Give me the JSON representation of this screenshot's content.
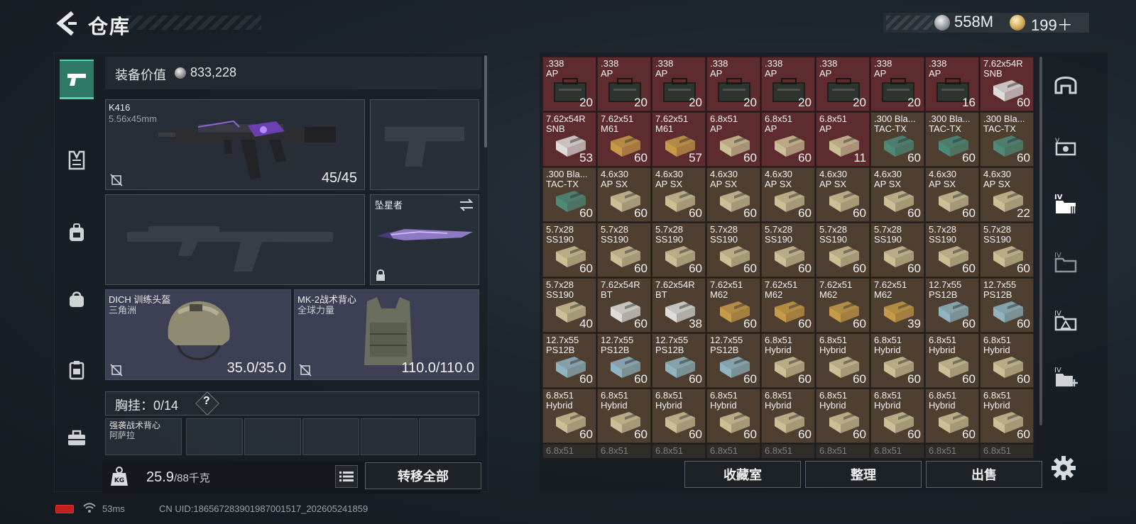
{
  "header": {
    "title": "仓库",
    "currency_1": "558M",
    "currency_2": "199＋"
  },
  "equipment": {
    "value_label": "装备价值",
    "value_amount": "833,228",
    "primary": {
      "name": "K416",
      "caliber": "5.56x45mm",
      "ammo": "45/45"
    },
    "melee": {
      "name": "坠星者"
    },
    "helmet": {
      "name": "DICH 训练头盔",
      "sub": "三角洲",
      "durability": "35.0/35.0"
    },
    "armor": {
      "name": "MK-2战术背心",
      "sub": "全球力量",
      "durability": "110.0/110.0"
    },
    "rig_label": "胸挂：0/14",
    "rig_help": "?",
    "rig_item_name": "强袭战术背心",
    "rig_item_sub": "阿萨拉",
    "weight_current": "25.9",
    "weight_max": "/88千克",
    "transfer_all": "转移全部"
  },
  "stash": {
    "cells": [
      {
        "l1": ".338",
        "l2": "AP",
        "qty": "20",
        "bg": "red",
        "box": "ammo-can"
      },
      {
        "l1": ".338",
        "l2": "AP",
        "qty": "20",
        "bg": "red",
        "box": "ammo-can"
      },
      {
        "l1": ".338",
        "l2": "AP",
        "qty": "20",
        "bg": "red",
        "box": "ammo-can"
      },
      {
        "l1": ".338",
        "l2": "AP",
        "qty": "20",
        "bg": "red",
        "box": "ammo-can"
      },
      {
        "l1": ".338",
        "l2": "AP",
        "qty": "20",
        "bg": "red",
        "box": "ammo-can"
      },
      {
        "l1": ".338",
        "l2": "AP",
        "qty": "20",
        "bg": "red",
        "box": "ammo-can"
      },
      {
        "l1": ".338",
        "l2": "AP",
        "qty": "20",
        "bg": "red",
        "box": "ammo-can"
      },
      {
        "l1": ".338",
        "l2": "AP",
        "qty": "16",
        "bg": "red",
        "box": "ammo-can"
      },
      {
        "l1": "7.62x54R",
        "l2": "SNB",
        "qty": "60",
        "bg": "red",
        "box": "white"
      },
      {
        "l1": "7.62x54R",
        "l2": "SNB",
        "qty": "53",
        "bg": "red",
        "box": "white"
      },
      {
        "l1": "7.62x51",
        "l2": "M61",
        "qty": "60",
        "bg": "red",
        "box": "gold"
      },
      {
        "l1": "7.62x51",
        "l2": "M61",
        "qty": "57",
        "bg": "red",
        "box": "gold"
      },
      {
        "l1": "6.8x51",
        "l2": "AP",
        "qty": "60",
        "bg": "red",
        "box": "tan"
      },
      {
        "l1": "6.8x51",
        "l2": "AP",
        "qty": "60",
        "bg": "red",
        "box": "tan"
      },
      {
        "l1": "6.8x51",
        "l2": "AP",
        "qty": "11",
        "bg": "red",
        "box": "tan"
      },
      {
        "l1": ".300 Bla...",
        "l2": "TAC-TX",
        "qty": "60",
        "bg": "brown",
        "box": "green"
      },
      {
        "l1": ".300 Bla...",
        "l2": "TAC-TX",
        "qty": "60",
        "bg": "brown",
        "box": "green"
      },
      {
        "l1": ".300 Bla...",
        "l2": "TAC-TX",
        "qty": "60",
        "bg": "brown",
        "box": "green"
      },
      {
        "l1": ".300 Bla...",
        "l2": "TAC-TX",
        "qty": "60",
        "bg": "brown",
        "box": "green"
      },
      {
        "l1": "4.6x30",
        "l2": "AP SX",
        "qty": "60",
        "bg": "brown",
        "box": "tan"
      },
      {
        "l1": "4.6x30",
        "l2": "AP SX",
        "qty": "60",
        "bg": "brown",
        "box": "tan"
      },
      {
        "l1": "4.6x30",
        "l2": "AP SX",
        "qty": "60",
        "bg": "brown",
        "box": "tan"
      },
      {
        "l1": "4.6x30",
        "l2": "AP SX",
        "qty": "60",
        "bg": "brown",
        "box": "tan"
      },
      {
        "l1": "4.6x30",
        "l2": "AP SX",
        "qty": "60",
        "bg": "brown",
        "box": "tan"
      },
      {
        "l1": "4.6x30",
        "l2": "AP SX",
        "qty": "60",
        "bg": "brown",
        "box": "tan"
      },
      {
        "l1": "4.6x30",
        "l2": "AP SX",
        "qty": "60",
        "bg": "brown",
        "box": "tan"
      },
      {
        "l1": "4.6x30",
        "l2": "AP SX",
        "qty": "22",
        "bg": "brown",
        "box": "tan"
      },
      {
        "l1": "5.7x28",
        "l2": "SS190",
        "qty": "60",
        "bg": "brown",
        "box": "tan"
      },
      {
        "l1": "5.7x28",
        "l2": "SS190",
        "qty": "60",
        "bg": "brown",
        "box": "tan"
      },
      {
        "l1": "5.7x28",
        "l2": "SS190",
        "qty": "60",
        "bg": "brown",
        "box": "tan"
      },
      {
        "l1": "5.7x28",
        "l2": "SS190",
        "qty": "60",
        "bg": "brown",
        "box": "tan"
      },
      {
        "l1": "5.7x28",
        "l2": "SS190",
        "qty": "60",
        "bg": "brown",
        "box": "tan"
      },
      {
        "l1": "5.7x28",
        "l2": "SS190",
        "qty": "60",
        "bg": "brown",
        "box": "tan"
      },
      {
        "l1": "5.7x28",
        "l2": "SS190",
        "qty": "60",
        "bg": "brown",
        "box": "tan"
      },
      {
        "l1": "5.7x28",
        "l2": "SS190",
        "qty": "60",
        "bg": "brown",
        "box": "tan"
      },
      {
        "l1": "5.7x28",
        "l2": "SS190",
        "qty": "60",
        "bg": "brown",
        "box": "tan"
      },
      {
        "l1": "5.7x28",
        "l2": "SS190",
        "qty": "40",
        "bg": "brown",
        "box": "tan"
      },
      {
        "l1": "7.62x54R",
        "l2": "BT",
        "qty": "60",
        "bg": "brown",
        "box": "white"
      },
      {
        "l1": "7.62x54R",
        "l2": "BT",
        "qty": "38",
        "bg": "brown",
        "box": "white"
      },
      {
        "l1": "7.62x51",
        "l2": "M62",
        "qty": "60",
        "bg": "brown",
        "box": "gold"
      },
      {
        "l1": "7.62x51",
        "l2": "M62",
        "qty": "60",
        "bg": "brown",
        "box": "gold"
      },
      {
        "l1": "7.62x51",
        "l2": "M62",
        "qty": "60",
        "bg": "brown",
        "box": "gold"
      },
      {
        "l1": "7.62x51",
        "l2": "M62",
        "qty": "39",
        "bg": "brown",
        "box": "gold"
      },
      {
        "l1": "12.7x55",
        "l2": "PS12B",
        "qty": "60",
        "bg": "brown",
        "box": "blue"
      },
      {
        "l1": "12.7x55",
        "l2": "PS12B",
        "qty": "60",
        "bg": "brown",
        "box": "blue"
      },
      {
        "l1": "12.7x55",
        "l2": "PS12B",
        "qty": "60",
        "bg": "brown",
        "box": "blue"
      },
      {
        "l1": "12.7x55",
        "l2": "PS12B",
        "qty": "60",
        "bg": "brown",
        "box": "blue"
      },
      {
        "l1": "12.7x55",
        "l2": "PS12B",
        "qty": "60",
        "bg": "brown",
        "box": "blue"
      },
      {
        "l1": "12.7x55",
        "l2": "PS12B",
        "qty": "60",
        "bg": "brown",
        "box": "blue"
      },
      {
        "l1": "6.8x51",
        "l2": "Hybrid",
        "qty": "60",
        "bg": "brown",
        "box": "tan"
      },
      {
        "l1": "6.8x51",
        "l2": "Hybrid",
        "qty": "60",
        "bg": "brown",
        "box": "tan"
      },
      {
        "l1": "6.8x51",
        "l2": "Hybrid",
        "qty": "60",
        "bg": "brown",
        "box": "tan"
      },
      {
        "l1": "6.8x51",
        "l2": "Hybrid",
        "qty": "60",
        "bg": "brown",
        "box": "tan"
      },
      {
        "l1": "6.8x51",
        "l2": "Hybrid",
        "qty": "60",
        "bg": "brown",
        "box": "tan"
      },
      {
        "l1": "6.8x51",
        "l2": "Hybrid",
        "qty": "60",
        "bg": "brown",
        "box": "tan"
      },
      {
        "l1": "6.8x51",
        "l2": "Hybrid",
        "qty": "60",
        "bg": "brown",
        "box": "tan"
      },
      {
        "l1": "6.8x51",
        "l2": "Hybrid",
        "qty": "60",
        "bg": "brown",
        "box": "tan"
      },
      {
        "l1": "6.8x51",
        "l2": "Hybrid",
        "qty": "60",
        "bg": "brown",
        "box": "tan"
      },
      {
        "l1": "6.8x51",
        "l2": "Hybrid",
        "qty": "60",
        "bg": "brown",
        "box": "tan"
      },
      {
        "l1": "6.8x51",
        "l2": "Hybrid",
        "qty": "60",
        "bg": "brown",
        "box": "tan"
      },
      {
        "l1": "6.8x51",
        "l2": "Hybrid",
        "qty": "60",
        "bg": "brown",
        "box": "tan"
      },
      {
        "l1": "6.8x51",
        "l2": "Hybrid",
        "qty": "60",
        "bg": "brown",
        "box": "tan"
      },
      {
        "l1": "6.8x51",
        "l2": "Hybrid",
        "qty": "60",
        "bg": "brown",
        "box": "tan"
      },
      {
        "l1": "6.8x51",
        "l2": "",
        "qty": "",
        "bg": "brown",
        "box": "tan",
        "faded": true
      },
      {
        "l1": "6.8x51",
        "l2": "",
        "qty": "",
        "bg": "brown",
        "box": "tan",
        "faded": true
      },
      {
        "l1": "6.8x51",
        "l2": "",
        "qty": "",
        "bg": "brown",
        "box": "tan",
        "faded": true
      },
      {
        "l1": "6.8x51",
        "l2": "",
        "qty": "",
        "bg": "brown",
        "box": "tan",
        "faded": true
      },
      {
        "l1": "6.8x51",
        "l2": "",
        "qty": "",
        "bg": "brown",
        "box": "tan",
        "faded": true
      },
      {
        "l1": "6.8x51",
        "l2": "",
        "qty": "",
        "bg": "brown",
        "box": "tan",
        "faded": true
      },
      {
        "l1": "6.8x51",
        "l2": "",
        "qty": "",
        "bg": "brown",
        "box": "tan",
        "faded": true
      },
      {
        "l1": "6.8x51",
        "l2": "",
        "qty": "",
        "bg": "brown",
        "box": "tan",
        "faded": true
      },
      {
        "l1": "6.8x51",
        "l2": "",
        "qty": "",
        "bg": "brown",
        "box": "tan",
        "faded": true
      }
    ],
    "box_colors": {
      "ammo-can": "#2e3430",
      "white": "#dcdcd8",
      "gold": "#c69a48",
      "tan": "#cbbf95",
      "green": "#4e8a78",
      "blue": "#8fb3c0"
    }
  },
  "buttons": {
    "collection": "收藏室",
    "sort": "整理",
    "sell": "出售"
  },
  "status": {
    "ping": "53ms",
    "uid": "CN UID:18656728390198700151​7_202605241859"
  },
  "icons": {
    "left_nav": [
      "pistol-icon",
      "rig-icon",
      "backpack-icon",
      "pouch-icon",
      "case-icon",
      "toolbox-icon"
    ],
    "right_nav": [
      "helmet-icon",
      "money-icon",
      "folder-iv-icon",
      "folder-iv-dim-icon",
      "triangle-iv-icon",
      "plus-iv-icon"
    ]
  }
}
